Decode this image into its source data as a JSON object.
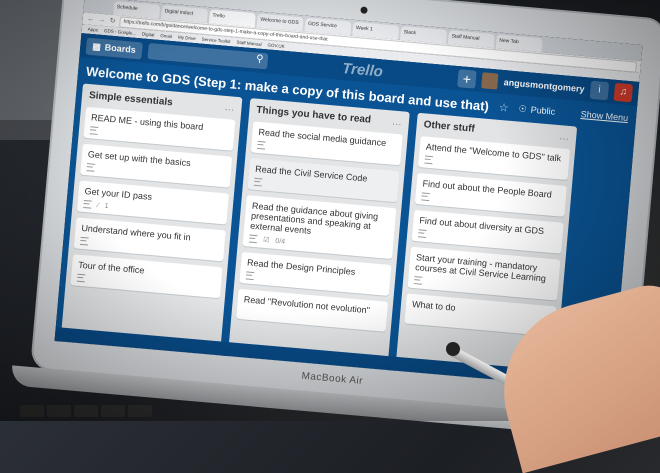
{
  "browser": {
    "tabs": [
      "Schedule",
      "Digital induct",
      "Trello",
      "Welcome to GDS",
      "GDS Service",
      "Week 1",
      "Slack",
      "Staff Manual",
      "New Tab"
    ],
    "url": "https://trello.com/b/guidance/welcome-to-gds-step-1-make-a-copy-of-this-board-and-use-that",
    "bookmarks": [
      "Apps",
      "GDS - Google...",
      "Digital",
      "Gmail",
      "My Drive",
      "Service Toolkit",
      "Staff Manual",
      "GOV.UK"
    ]
  },
  "trello": {
    "boards_label": "Boards",
    "logo": "Trello",
    "username": "angusmontgomery",
    "board_title": "Welcome to GDS (Step 1: make a copy of this board and use that)",
    "visibility": "Public",
    "show_menu": "Show Menu",
    "colors": {
      "board_bg": "#0a5495",
      "header": "#084a86",
      "notification": "#d33b2c"
    }
  },
  "lists": [
    {
      "title": "Simple essentials",
      "cards": [
        {
          "title": "READ ME - using this board",
          "desc": true
        },
        {
          "title": "Get set up with the basics",
          "desc": true
        },
        {
          "title": "Get your ID pass",
          "desc": true,
          "attachments": "1"
        },
        {
          "title": "Understand where you fit in",
          "desc": true
        },
        {
          "title": "Tour of the office",
          "desc": true
        }
      ]
    },
    {
      "title": "Things you have to read",
      "cards": [
        {
          "title": "Read the social media guidance",
          "desc": true
        },
        {
          "title": "Read the Civil Service Code",
          "desc": true
        },
        {
          "title": "Read the guidance about giving presentations and speaking at external events",
          "desc": true,
          "checklist": "0/4"
        },
        {
          "title": "Read the Design Principles",
          "desc": true
        },
        {
          "title": "Read \"Revolution not evolution\"",
          "desc": false
        }
      ]
    },
    {
      "title": "Other stuff",
      "cards": [
        {
          "title": "Attend the \"Welcome to GDS\" talk",
          "desc": true
        },
        {
          "title": "Find out about the People Board",
          "desc": true
        },
        {
          "title": "Find out about diversity at GDS",
          "desc": true
        },
        {
          "title": "Start your training - mandatory courses at Civil Service Learning",
          "desc": true
        },
        {
          "title": "What to do",
          "desc": false
        }
      ]
    }
  ],
  "laptop": {
    "brand": "MacBook Air"
  }
}
